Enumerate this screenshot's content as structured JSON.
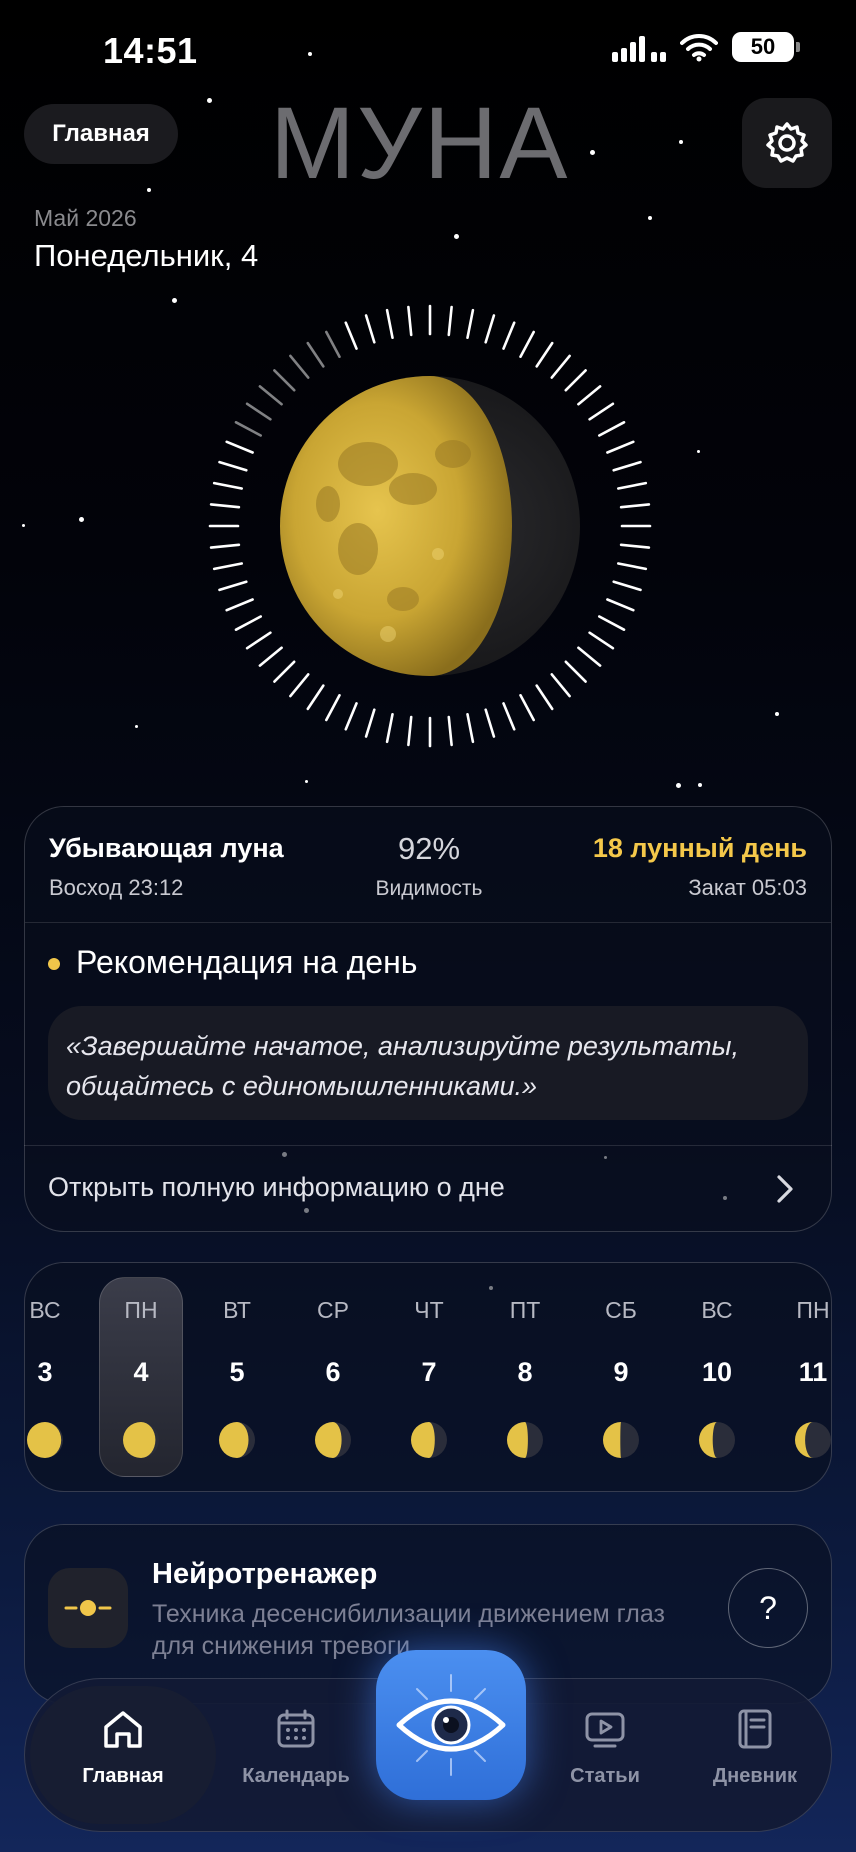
{
  "status_bar": {
    "time": "14:51",
    "battery": "50"
  },
  "header": {
    "home_pill": "Главная",
    "brand": "МУНА",
    "date_month": "Май 2026",
    "date_day": "Понедельник, 4"
  },
  "moon": {
    "phase_name": "Убывающая луна",
    "moonrise": "Восход 23:12",
    "visibility": "92%",
    "visibility_label": "Видимость",
    "lunar_day": "18 лунный день",
    "moonset": "Закат 05:03"
  },
  "recommendation": {
    "title": "Рекомендация на день",
    "quote_line1": "«Завершайте начатое, анализируйте результаты,",
    "quote_line2": "общайтесь с единомышленниками.»",
    "open_full": "Открыть полную информацию о дне"
  },
  "week": [
    {
      "dow": "ВС",
      "num": "3"
    },
    {
      "dow": "ПН",
      "num": "4",
      "selected": true
    },
    {
      "dow": "ВТ",
      "num": "5"
    },
    {
      "dow": "СР",
      "num": "6"
    },
    {
      "dow": "ЧТ",
      "num": "7"
    },
    {
      "dow": "ПТ",
      "num": "8"
    },
    {
      "dow": "СБ",
      "num": "9"
    },
    {
      "dow": "ВС",
      "num": "10"
    },
    {
      "dow": "ПН",
      "num": "11"
    }
  ],
  "neuro": {
    "title": "Нейротренажер",
    "desc": "Техника десенсибилизации движением глаз для снижения тревоги",
    "help": "?"
  },
  "tabbar": {
    "home": "Главная",
    "calendar": "Календарь",
    "articles": "Статьи",
    "diary": "Дневник"
  },
  "icons": [
    "settings-gear-icon",
    "home-icon",
    "calendar-icon",
    "eye-icon",
    "articles-play-icon",
    "diary-icon",
    "chevron-right-icon"
  ],
  "colors": {
    "accent_gold": "#f4c84a",
    "brand_gray": "#6c6c70",
    "eye_button_blue": "#3f80e6"
  }
}
